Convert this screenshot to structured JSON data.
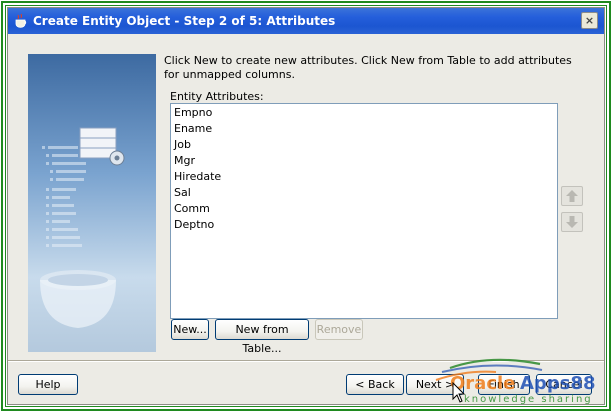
{
  "window": {
    "title": "Create Entity Object - Step 2 of 5: Attributes",
    "close_label": "×"
  },
  "main": {
    "instructions": "Click New to create new attributes.  Click New from Table to add attributes for unmapped columns.",
    "list_label": "Entity Attributes:",
    "attributes": [
      "Empno",
      "Ename",
      "Job",
      "Mgr",
      "Hiredate",
      "Sal",
      "Comm",
      "Deptno"
    ],
    "new_label": "New...",
    "new_from_table_label": "New from Table...",
    "remove_label": "Remove"
  },
  "footer": {
    "help_label": "Help",
    "back_label": "< Back",
    "next_label": "Next >",
    "finish_label": "Finish",
    "cancel_label": "Cancel"
  },
  "watermark": {
    "brand_part1": "Oracle",
    "brand_part2": "Apps88",
    "tagline": "knowledge sharing"
  },
  "colors": {
    "titlebar": "#245edb",
    "frame": "#1f8a1f",
    "dialog_bg": "#ecebe5"
  },
  "icons": [
    "wizard-cup-icon",
    "close-icon",
    "move-up-icon",
    "move-down-icon",
    "mouse-cursor-icon"
  ]
}
